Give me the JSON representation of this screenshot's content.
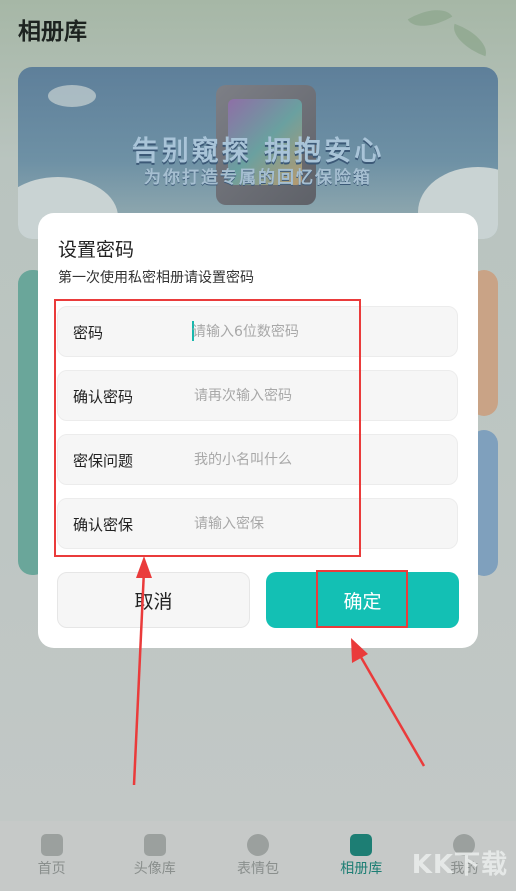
{
  "header": {
    "title": "相册库"
  },
  "banner": {
    "title": "告别窥探 拥抱安心",
    "subtitle": "为你打造专属的回忆保险箱"
  },
  "dialog": {
    "title": "设置密码",
    "subtitle": "第一次使用私密相册请设置密码",
    "fields": [
      {
        "label": "密码",
        "placeholder": "请输入6位数密码",
        "value": ""
      },
      {
        "label": "确认密码",
        "placeholder": "请再次输入密码",
        "value": ""
      },
      {
        "label": "密保问题",
        "placeholder": "我的小名叫什么",
        "value": ""
      },
      {
        "label": "确认密保",
        "placeholder": "请输入密保",
        "value": ""
      }
    ],
    "cancel_label": "取消",
    "confirm_label": "确定"
  },
  "tabbar": {
    "items": [
      {
        "label": "首页",
        "icon": "home-icon"
      },
      {
        "label": "头像库",
        "icon": "avatar-icon"
      },
      {
        "label": "表情包",
        "icon": "emoji-icon"
      },
      {
        "label": "相册库",
        "icon": "album-icon",
        "active": true
      },
      {
        "label": "我的",
        "icon": "profile-icon"
      }
    ]
  },
  "watermark": "KK下载",
  "colors": {
    "accent": "#13c0b4",
    "annotation": "#ea3b3b"
  }
}
